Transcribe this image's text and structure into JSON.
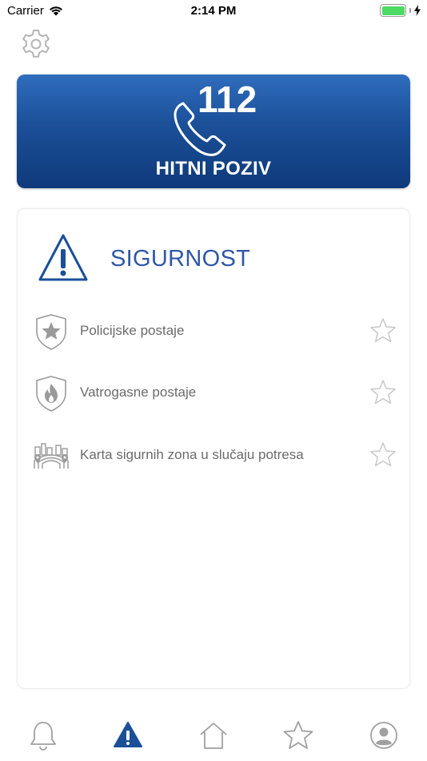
{
  "status_bar": {
    "carrier": "Carrier",
    "time": "2:14 PM"
  },
  "emergency": {
    "number": "112",
    "label": "HITNI POZIV"
  },
  "safety": {
    "title": "SIGURNOST",
    "items": [
      {
        "label": "Policijske postaje",
        "icon": "police-badge-icon"
      },
      {
        "label": "Vatrogasne postaje",
        "icon": "fire-shield-icon"
      },
      {
        "label": "Karta sigurnih zona u slučaju potresa",
        "icon": "earthquake-map-icon"
      }
    ]
  },
  "tabs": [
    {
      "icon": "bell-icon",
      "active": false
    },
    {
      "icon": "warning-icon",
      "active": true
    },
    {
      "icon": "home-icon",
      "active": false
    },
    {
      "icon": "star-icon",
      "active": false
    },
    {
      "icon": "profile-icon",
      "active": false
    }
  ],
  "colors": {
    "primary_blue": "#1b4f98",
    "title_blue": "#2f57a8",
    "icon_gray": "#a0a0a0",
    "battery_green": "#4cd964"
  }
}
